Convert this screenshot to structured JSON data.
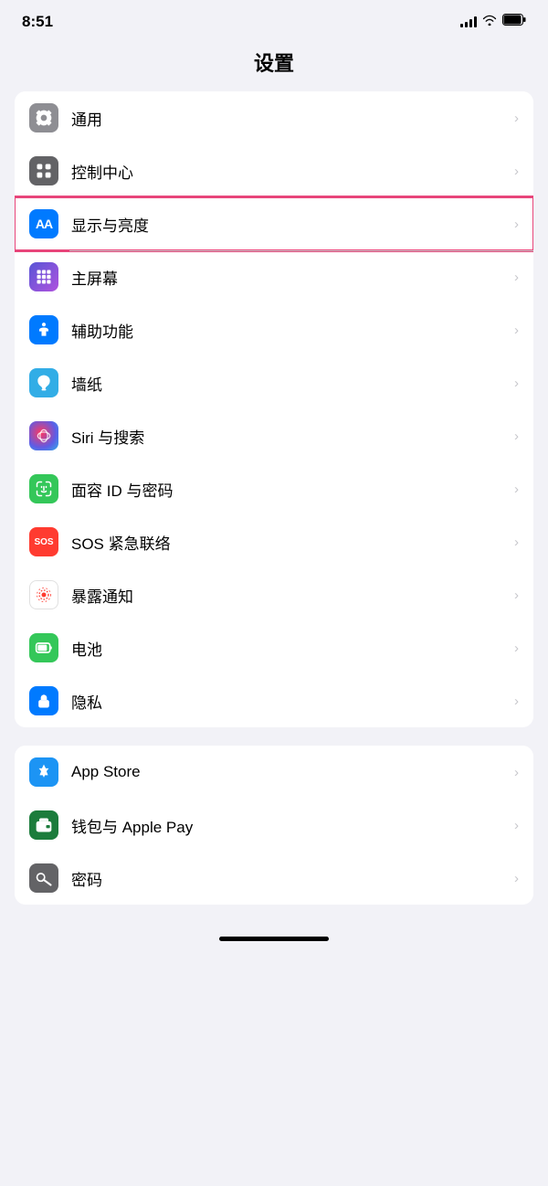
{
  "statusBar": {
    "time": "8:51",
    "signalLabel": "signal",
    "wifiLabel": "wifi",
    "batteryLabel": "battery"
  },
  "pageTitle": "设置",
  "sections": [
    {
      "id": "section1",
      "items": [
        {
          "id": "general",
          "label": "通用",
          "iconColor": "icon-gray",
          "iconType": "gear",
          "highlighted": false
        },
        {
          "id": "control-center",
          "label": "控制中心",
          "iconColor": "icon-gray2",
          "iconType": "toggle",
          "highlighted": false
        },
        {
          "id": "display",
          "label": "显示与亮度",
          "iconColor": "icon-blue",
          "iconType": "aa",
          "highlighted": true
        },
        {
          "id": "home-screen",
          "label": "主屏幕",
          "iconColor": "icon-purple",
          "iconType": "grid",
          "highlighted": false
        },
        {
          "id": "accessibility",
          "label": "辅助功能",
          "iconColor": "icon-blue2",
          "iconType": "accessibility",
          "highlighted": false
        },
        {
          "id": "wallpaper",
          "label": "墙纸",
          "iconColor": "icon-teal2",
          "iconType": "flower",
          "highlighted": false
        },
        {
          "id": "siri",
          "label": "Siri 与搜索",
          "iconColor": "icon-indigo",
          "iconType": "siri",
          "highlighted": false
        },
        {
          "id": "faceid",
          "label": "面容 ID 与密码",
          "iconColor": "icon-green",
          "iconType": "faceid",
          "highlighted": false
        },
        {
          "id": "sos",
          "label": "SOS 紧急联络",
          "iconColor": "icon-red",
          "iconType": "sos",
          "highlighted": false
        },
        {
          "id": "exposure",
          "label": "暴露通知",
          "iconColor": "icon-red2",
          "iconType": "exposure",
          "highlighted": false
        },
        {
          "id": "battery",
          "label": "电池",
          "iconColor": "icon-green",
          "iconType": "battery",
          "highlighted": false
        },
        {
          "id": "privacy",
          "label": "隐私",
          "iconColor": "icon-blue",
          "iconType": "hand",
          "highlighted": false
        }
      ]
    },
    {
      "id": "section2",
      "items": [
        {
          "id": "appstore",
          "label": "App Store",
          "iconColor": "icon-appstore",
          "iconType": "appstore",
          "highlighted": false
        },
        {
          "id": "wallet",
          "label": "钱包与 Apple Pay",
          "iconColor": "icon-wallet",
          "iconType": "wallet",
          "highlighted": false
        },
        {
          "id": "passwords",
          "label": "密码",
          "iconColor": "icon-password",
          "iconType": "key",
          "highlighted": false
        }
      ]
    }
  ]
}
